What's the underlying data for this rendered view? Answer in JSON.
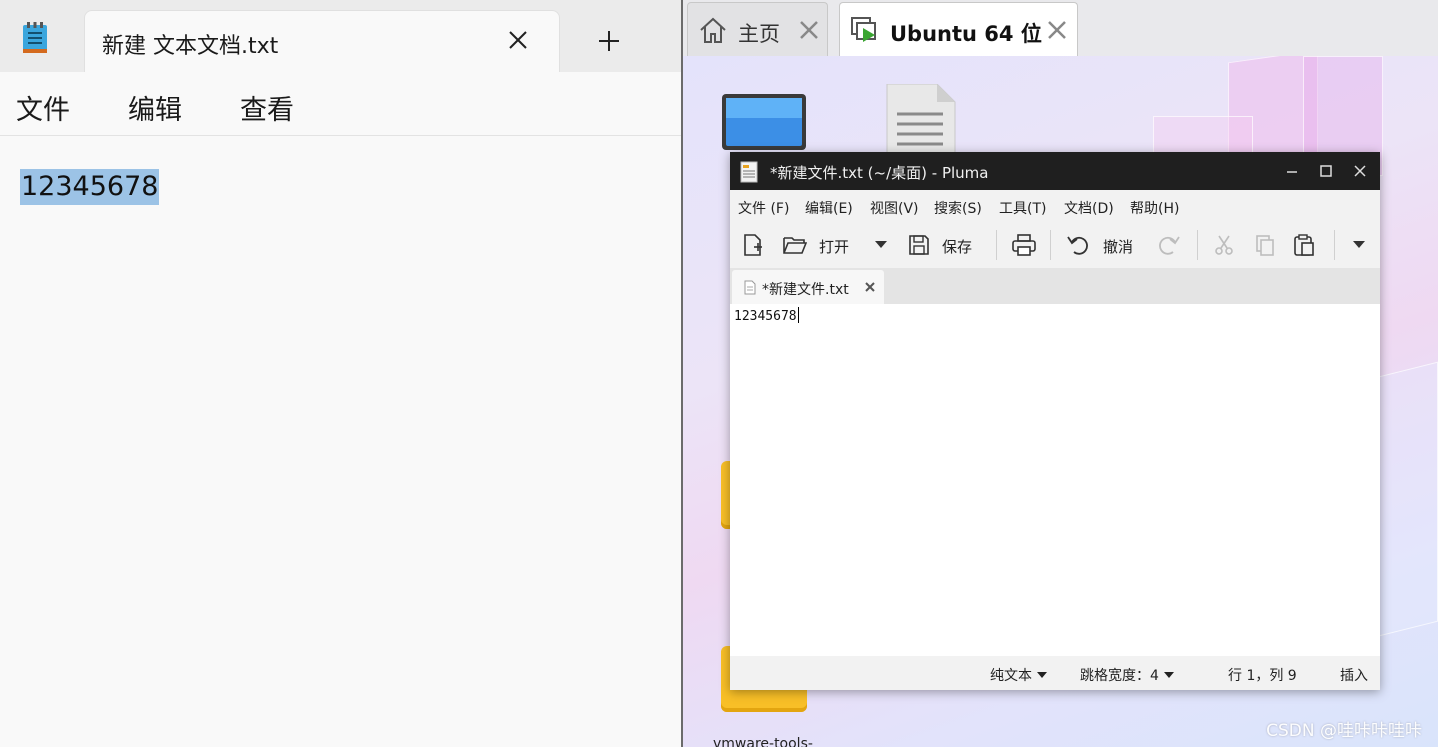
{
  "left_notepad": {
    "tab_title": "新建 文本文档.txt",
    "menu": [
      "文件",
      "编辑",
      "查看"
    ],
    "content": "12345678"
  },
  "vmware": {
    "tabs": [
      {
        "label": "主页",
        "icon": "home-icon"
      },
      {
        "label": "Ubuntu 64 位",
        "icon": "vm-play-icon"
      }
    ],
    "desktop_label": "vmware-tools-",
    "watermark": "CSDN @哇咔咔哇咔"
  },
  "pluma": {
    "title": "*新建文件.txt (~/桌面) - Pluma",
    "menu": [
      "文件 (F)",
      "编辑(E)",
      "视图(V)",
      "搜索(S)",
      "工具(T)",
      "文档(D)",
      "帮助(H)"
    ],
    "toolbar": {
      "open": "打开",
      "save": "保存",
      "undo": "撤消"
    },
    "tab_label": "*新建文件.txt",
    "content": "12345678",
    "status": {
      "mode": "纯文本",
      "tab_width": "跳格宽度：4",
      "position": "行 1，列 9",
      "insert": "插入"
    }
  }
}
